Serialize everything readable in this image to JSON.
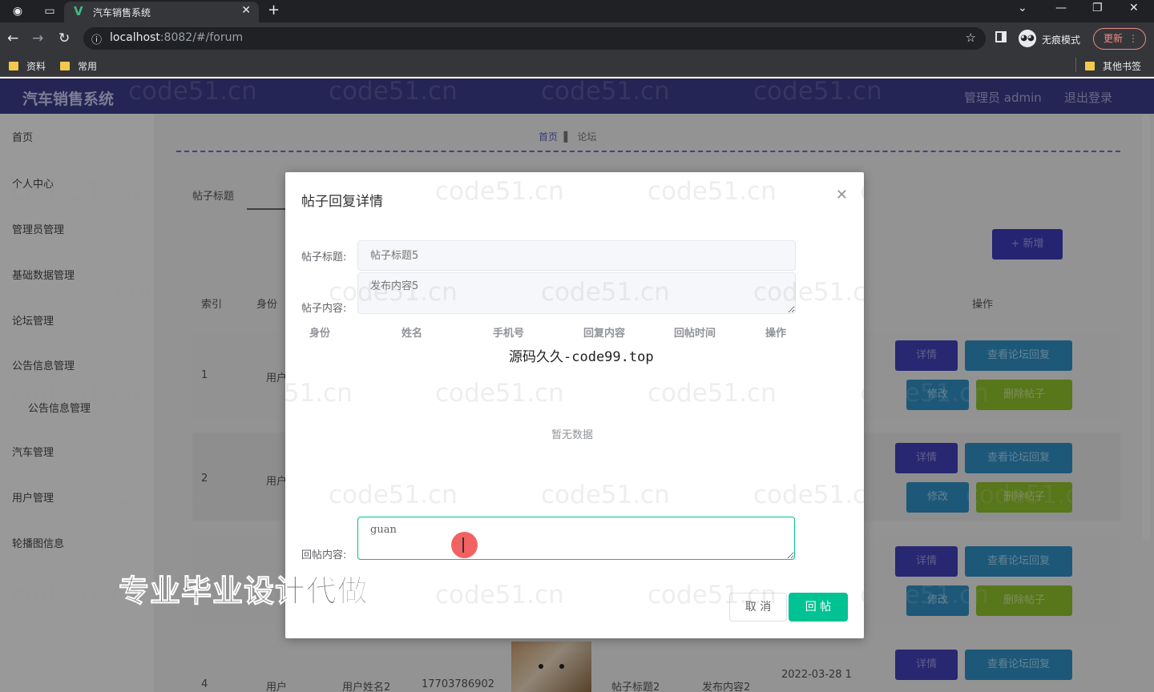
{
  "browser": {
    "tab_title": "汽车销售系统",
    "url_host": "localhost",
    "url_rest": ":8082/#/forum",
    "incognito_label": "无痕模式",
    "update_label": "更新",
    "bookmarks": [
      "资料",
      "常用"
    ],
    "other_bookmarks": "其他书签"
  },
  "app": {
    "brand": "汽车销售系统",
    "admin_label": "管理员 admin",
    "logout_label": "退出登录"
  },
  "sidebar": {
    "items": [
      "首页",
      "个人中心",
      "管理员管理",
      "基础数据管理",
      "论坛管理",
      "公告信息管理",
      "公告信息管理",
      "汽车管理",
      "用户管理",
      "轮播图信息"
    ]
  },
  "page": {
    "breadcrumb_home": "首页",
    "breadcrumb_current": "论坛",
    "filter_label": "帖子标题",
    "add_button": "+ 新增",
    "columns": {
      "index": "索引",
      "identity": "身份",
      "action": "操作"
    },
    "rows": [
      {
        "index": "1",
        "identity": "用户"
      },
      {
        "index": "2",
        "identity": "用户"
      },
      {
        "index": "4",
        "identity": "用户",
        "name": "用户姓名2",
        "phone": "17703786902",
        "title": "帖子标题2",
        "content": "发布内容2",
        "time": "2022-03-28 1"
      }
    ],
    "actions": {
      "detail": "详情",
      "view_replies": "查看论坛回复",
      "edit": "修改",
      "delete": "删除帖子"
    }
  },
  "dialog": {
    "title": "帖子回复详情",
    "title_label": "帖子标题:",
    "title_value": "帖子标题5",
    "content_label": "帖子内容:",
    "content_value": "发布内容5",
    "table_headers": [
      "身份",
      "姓名",
      "手机号",
      "回复内容",
      "回帖时间",
      "操作"
    ],
    "empty_text": "暂无数据",
    "reply_label": "回帖内容:",
    "reply_value": "guan",
    "cancel_label": "取 消",
    "submit_label": "回 帖"
  },
  "overlays": {
    "site_watermark": "源码久久-code99.top",
    "promo_text": "专业毕业设计代做",
    "tiled_watermark": "code51.cn"
  }
}
